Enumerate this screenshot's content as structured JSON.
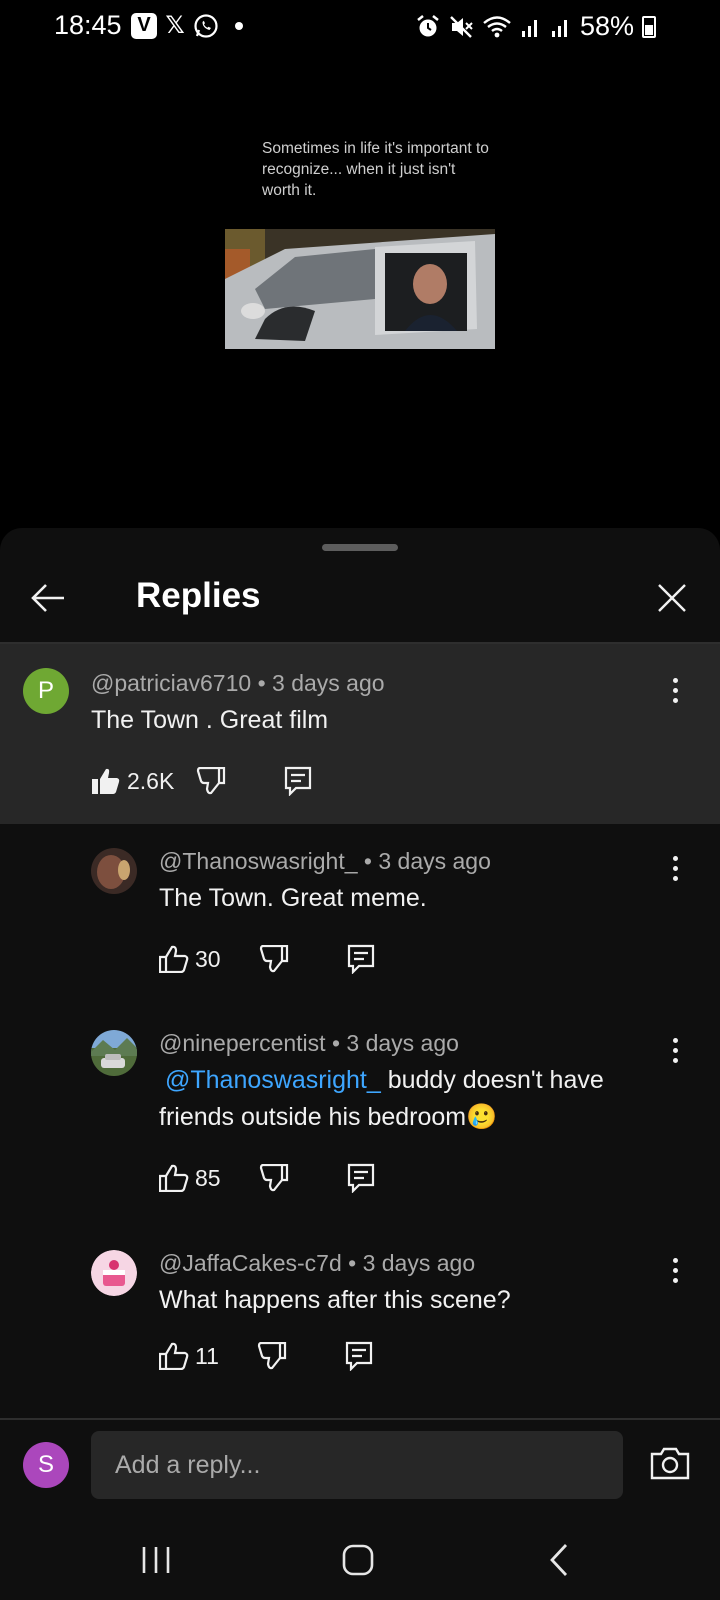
{
  "status_bar": {
    "time": "18:45",
    "app_icon_letter": "V",
    "x_icon": "𝕏",
    "battery": "58%",
    "icons": [
      "vimeo-icon",
      "x-icon",
      "whatsapp-icon",
      "alarm-icon",
      "mute-icon",
      "wifi-icon",
      "signal-icon",
      "signal-icon",
      "battery-icon"
    ]
  },
  "video": {
    "caption": "Sometimes in life it's important to recognize... when it just isn't worth it."
  },
  "sheet": {
    "title": "Replies"
  },
  "parent_comment": {
    "avatar_letter": "P",
    "avatar_color": "#6fa833",
    "author": "@patriciav6710",
    "time_ago": "3 days ago",
    "text": "The Town . Great film",
    "likes": "2.6K"
  },
  "replies": [
    {
      "author": "@Thanoswasright_",
      "time_ago": "3 days ago",
      "text": "The Town. Great meme.",
      "likes": "30"
    },
    {
      "author": "@ninepercentist",
      "time_ago": "3 days ago",
      "mention": "@Thanoswasright_",
      "text": " buddy doesn't have friends outside his bedroom",
      "emoji": "🥲",
      "likes": "85"
    },
    {
      "author": "@JaffaCakes-c7d",
      "time_ago": "3 days ago",
      "text": "What happens after this scene?",
      "likes": "11"
    }
  ],
  "reply_bar": {
    "avatar_letter": "S",
    "placeholder": "Add a reply..."
  },
  "colors": {
    "sheet_bg": "#0f0f0f",
    "highlight_bg": "#272727",
    "mention": "#3ea6ff",
    "user_avatar": "#ab47bc"
  }
}
